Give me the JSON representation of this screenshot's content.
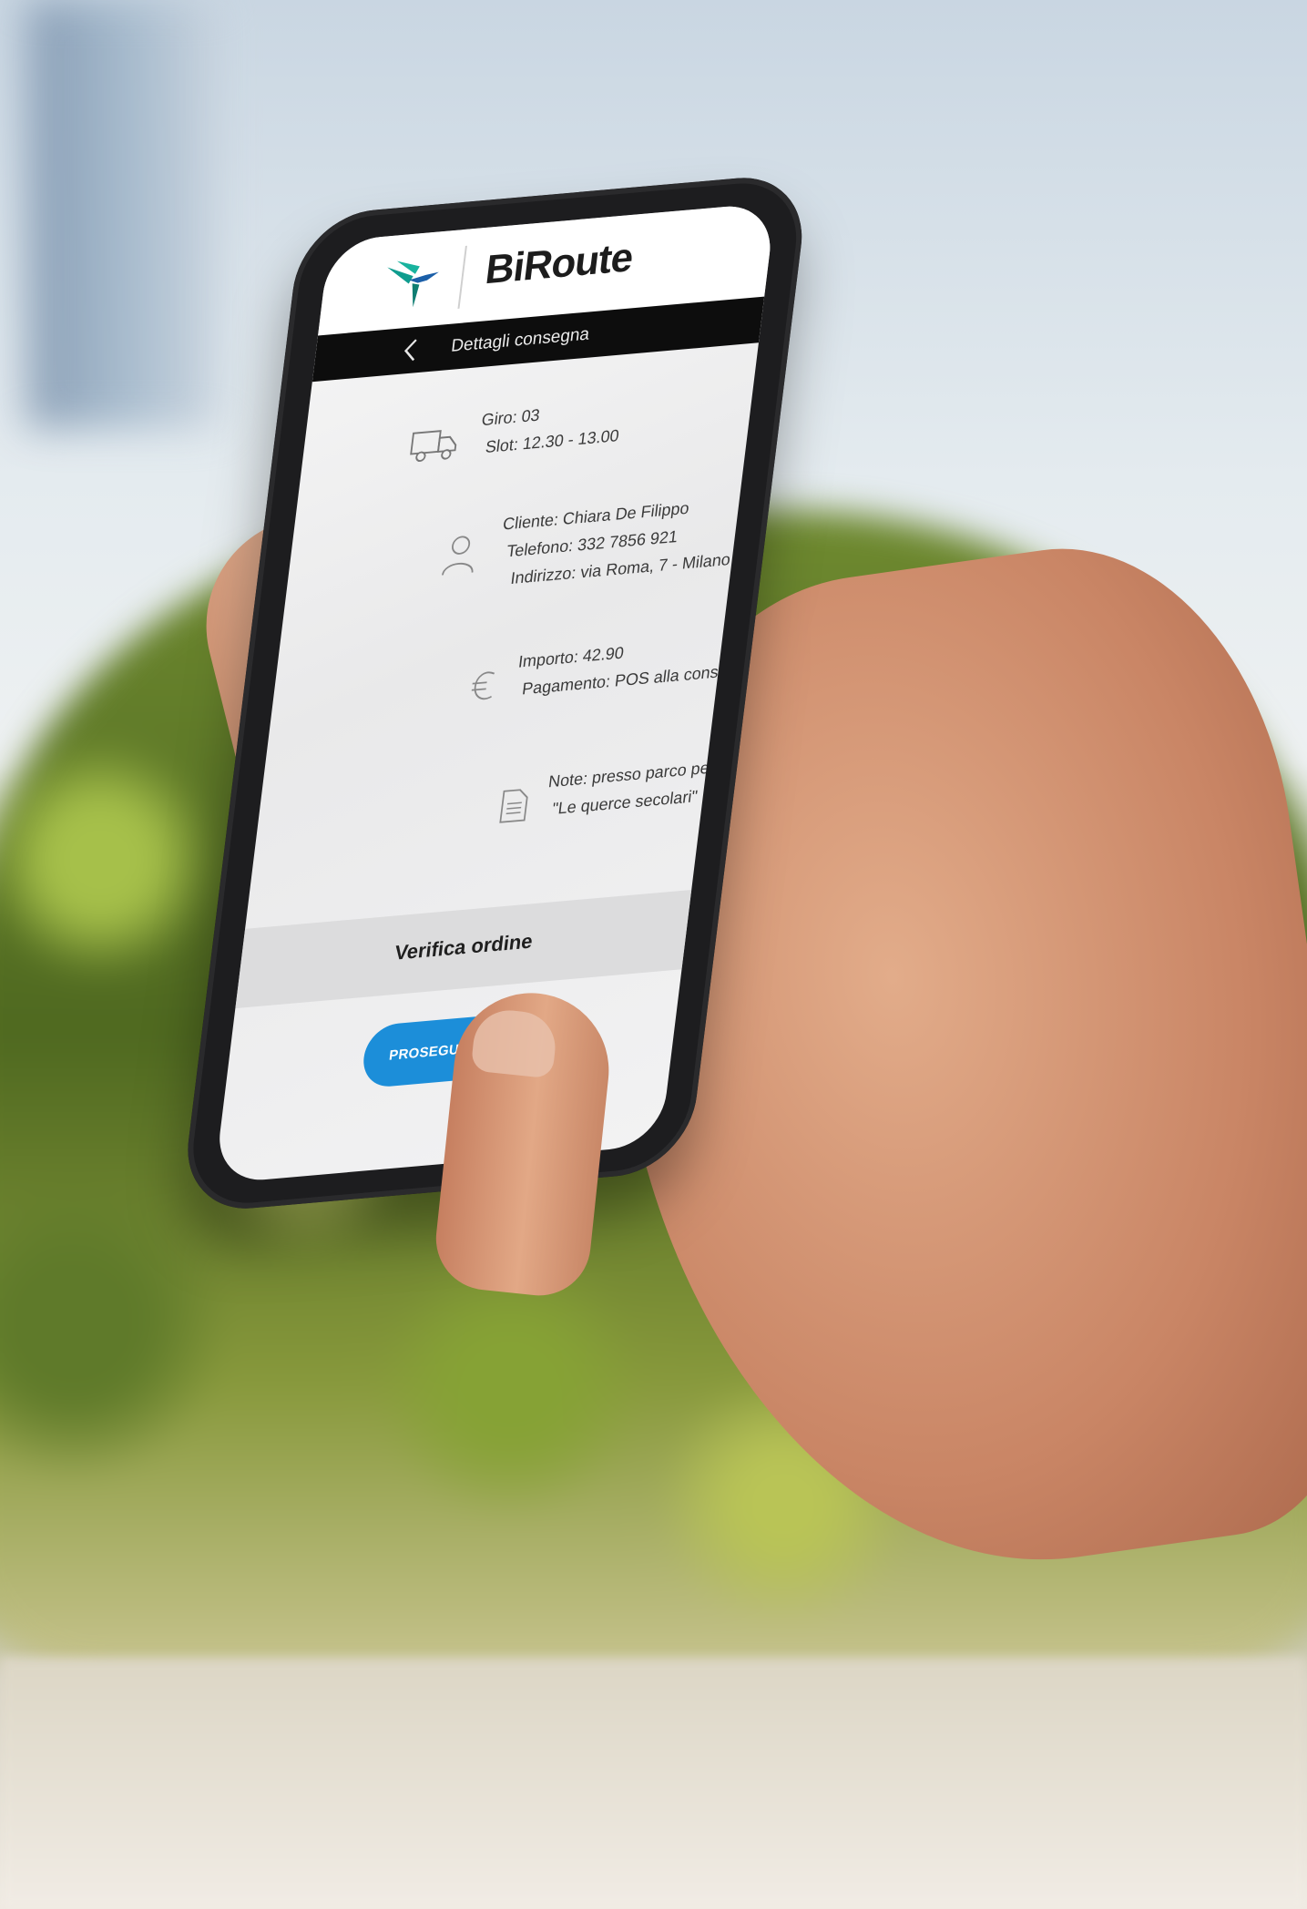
{
  "app": {
    "brand": "BiRoute",
    "screen_title": "Dettagli consegna"
  },
  "delivery": {
    "giro": "Giro: 03",
    "slot": "Slot: 12.30 - 13.00",
    "cliente": "Cliente: Chiara De Filippo",
    "telefono": "Telefono: 332 7856 921",
    "indirizzo": "Indirizzo: via Roma, 7 - Milano",
    "importo": "Importo: 42.90",
    "pagamento": "Pagamento: POS alla consegna",
    "note_line1": "Note: presso parco pedonale",
    "note_line2": "\"Le querce secolari\""
  },
  "actions": {
    "verify": "Verifica ordine",
    "continue": "PROSEGUI CONSEGNE"
  },
  "icons": {
    "logo": "hummingbird-icon",
    "back": "chevron-left-icon",
    "truck": "truck-icon",
    "person": "person-icon",
    "euro": "euro-icon",
    "note": "document-icon"
  },
  "colors": {
    "accent": "#1c8ed9",
    "nav_bar": "#0d0d0d",
    "logo_teal": "#0f9c8e",
    "logo_blue": "#1b5fa8"
  }
}
